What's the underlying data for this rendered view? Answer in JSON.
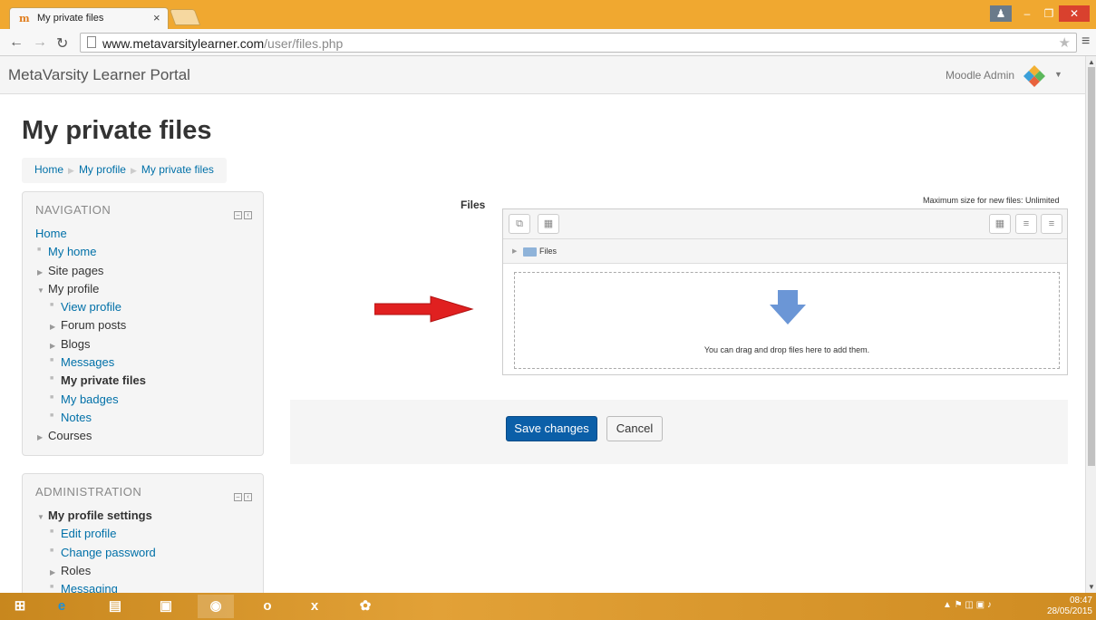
{
  "browser": {
    "tab_title": "My private files",
    "tab_favicon": "m",
    "tab_close": "×",
    "url_host": "www.metavarsitylearner.com",
    "url_path": "/user/files.php"
  },
  "header": {
    "site_name": "MetaVarsity Learner Portal",
    "user_name": "Moodle Admin"
  },
  "page": {
    "title": "My private files",
    "breadcrumb": [
      "Home",
      "My profile",
      "My private files"
    ]
  },
  "navigation": {
    "title": "NAVIGATION",
    "items": [
      {
        "label": "Home",
        "level": 0,
        "kind": "link"
      },
      {
        "label": "My home",
        "level": 1,
        "kind": "link"
      },
      {
        "label": "Site pages",
        "level": 1,
        "kind": "expandable"
      },
      {
        "label": "My profile",
        "level": 1,
        "kind": "expanded"
      },
      {
        "label": "View profile",
        "level": 2,
        "kind": "link"
      },
      {
        "label": "Forum posts",
        "level": 2,
        "kind": "expandable"
      },
      {
        "label": "Blogs",
        "level": 2,
        "kind": "expandable"
      },
      {
        "label": "Messages",
        "level": 2,
        "kind": "link"
      },
      {
        "label": "My private files",
        "level": 2,
        "kind": "current"
      },
      {
        "label": "My badges",
        "level": 2,
        "kind": "link"
      },
      {
        "label": "Notes",
        "level": 2,
        "kind": "link"
      },
      {
        "label": "Courses",
        "level": 1,
        "kind": "expandable"
      }
    ]
  },
  "administration": {
    "title": "ADMINISTRATION",
    "items": [
      {
        "label": "My profile settings",
        "level": 1,
        "kind": "expanded-bold"
      },
      {
        "label": "Edit profile",
        "level": 2,
        "kind": "link"
      },
      {
        "label": "Change password",
        "level": 2,
        "kind": "link"
      },
      {
        "label": "Roles",
        "level": 2,
        "kind": "expandable"
      },
      {
        "label": "Messaging",
        "level": 2,
        "kind": "link"
      }
    ]
  },
  "files": {
    "label": "Files",
    "max_size": "Maximum size for new files: Unlimited",
    "folder_name": "Files",
    "drop_text": "You can drag and drop files here to add them."
  },
  "form": {
    "save_label": "Save changes",
    "cancel_label": "Cancel"
  },
  "taskbar": {
    "time": "08:47",
    "date": "28/05/2015"
  },
  "colors": {
    "accent": "#0b5fa8",
    "link": "#0070a8",
    "window_frame": "#f0a830",
    "drop_arrow": "#6b96d6",
    "annotation_arrow": "#e02020"
  }
}
